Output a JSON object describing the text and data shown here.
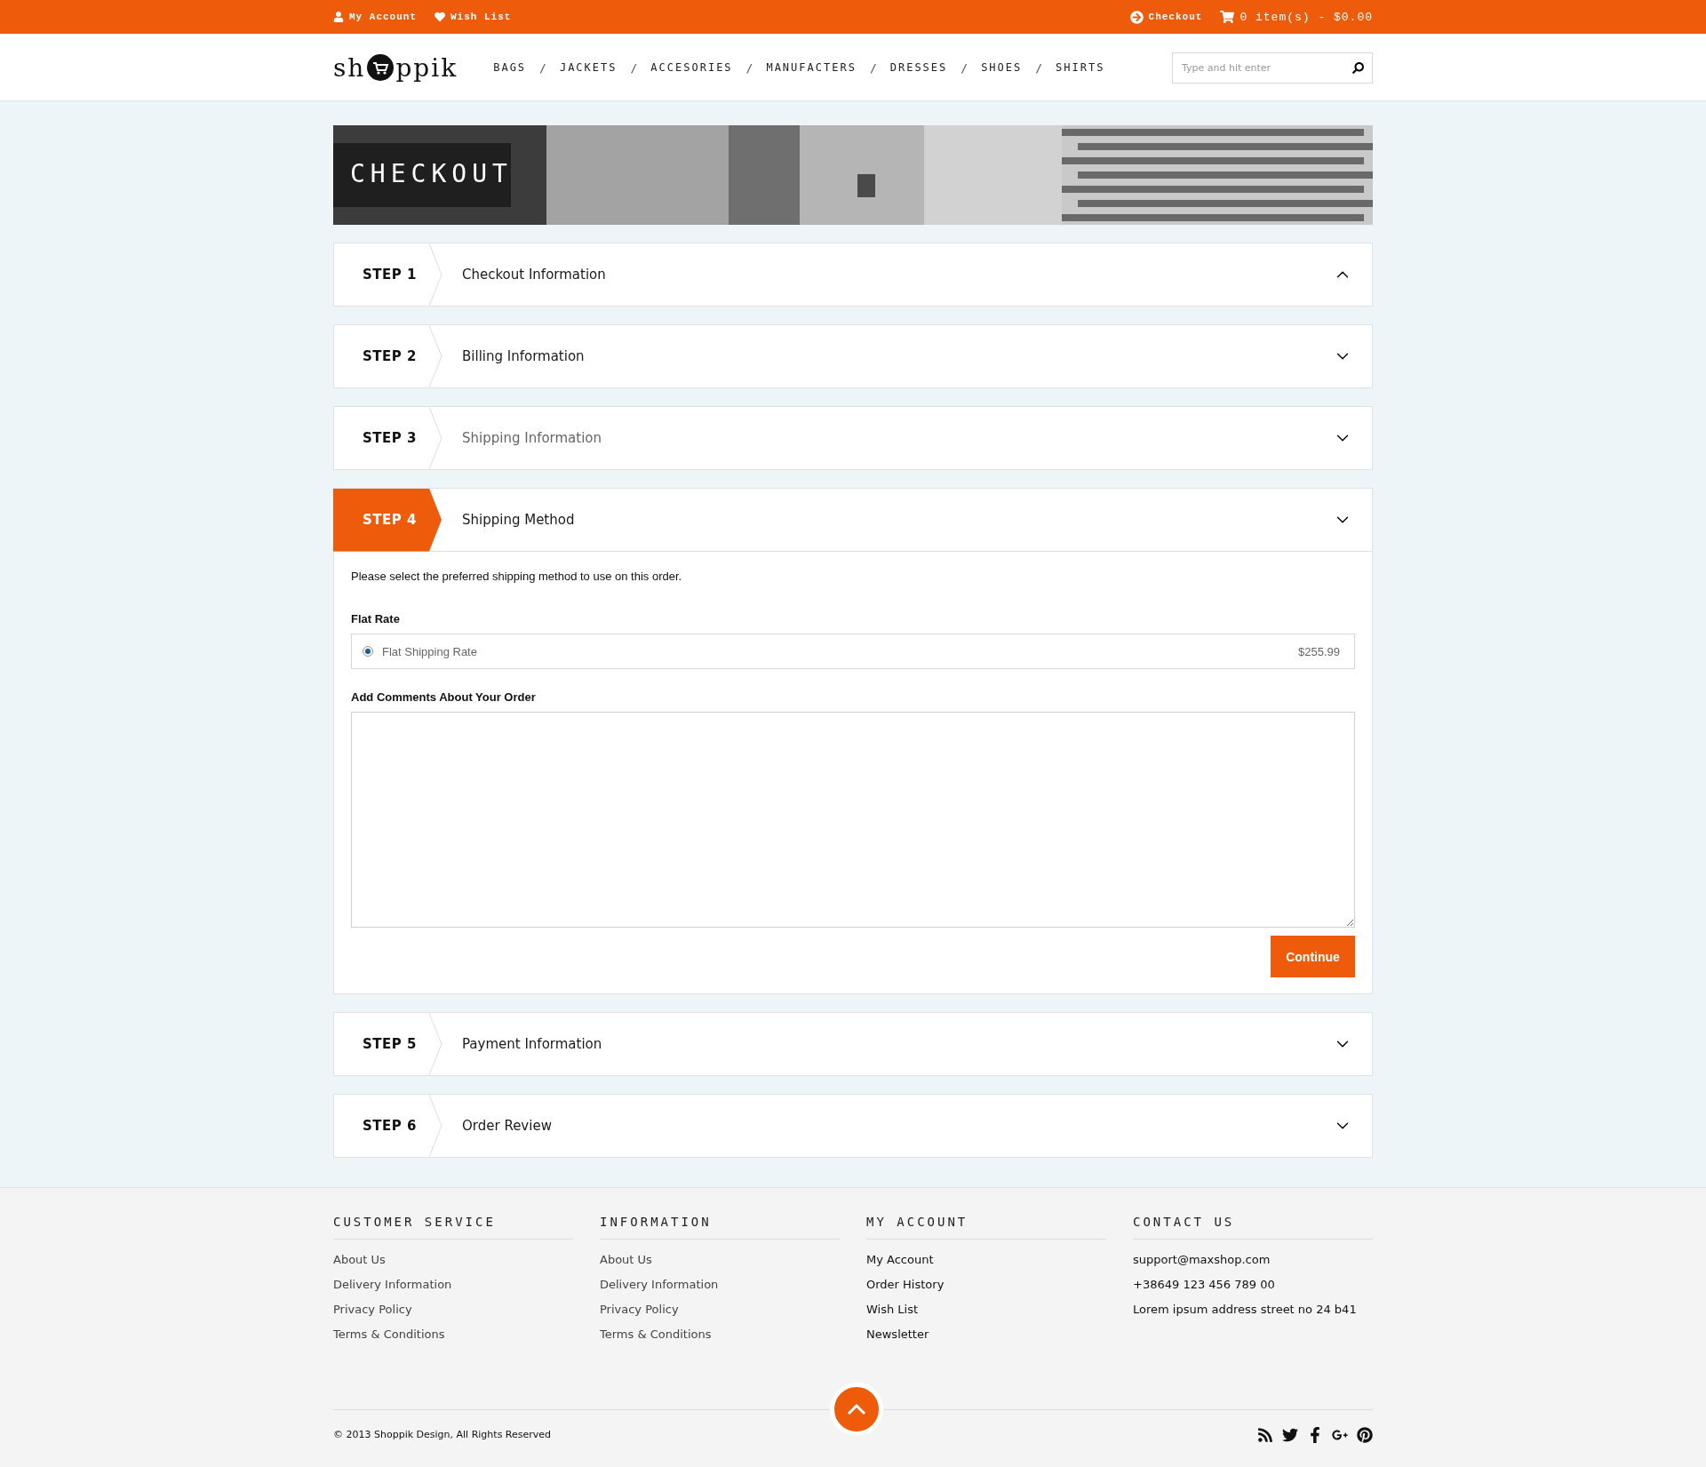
{
  "top_bar": {
    "left": [
      {
        "kind": "user",
        "label": "My Account"
      },
      {
        "kind": "heart",
        "label": "Wish List"
      }
    ],
    "checkout": "Checkout",
    "cart": "0 item(s) - $0.00"
  },
  "header": {
    "logo": {
      "before": "sh",
      "after": "ppik"
    },
    "nav": [
      "BAGS",
      "JACKETS",
      "ACCESORIES",
      "MANUFACTERS",
      "DRESSES",
      "SHOES",
      "SHIRTS"
    ],
    "separator": "/",
    "search": {
      "placeholder": "Type and hit enter"
    }
  },
  "banner": {
    "title": "CHECKOUT"
  },
  "steps": [
    {
      "step": "STEP 1",
      "title": "Checkout Information",
      "selected": false,
      "expanded": true,
      "disabled": false
    },
    {
      "step": "STEP 2",
      "title": "Billing Information",
      "selected": false,
      "expanded": false,
      "disabled": false
    },
    {
      "step": "STEP 3",
      "title": "Shipping Information",
      "selected": false,
      "expanded": false,
      "disabled": true
    },
    {
      "step": "STEP 4",
      "title": "Shipping Method",
      "selected": true,
      "expanded": false,
      "disabled": false
    },
    {
      "step": "STEP 5",
      "title": "Payment Information",
      "selected": false,
      "expanded": false,
      "disabled": false
    },
    {
      "step": "STEP 6",
      "title": "Order Review",
      "selected": false,
      "expanded": false,
      "disabled": false
    }
  ],
  "shipping_method": {
    "intro": "Please select the preferred shipping method to use on this order.",
    "group": "Flat Rate",
    "options": [
      {
        "label": "Flat Shipping Rate",
        "price": "$255.99",
        "selected": true
      }
    ],
    "comments_label": "Add Comments About Your Order",
    "button": "Continue"
  },
  "footer": {
    "columns": [
      {
        "heading": "CUSTOMER SERVICE",
        "kind": "links",
        "items": [
          "About Us",
          "Delivery Information",
          "Privacy Policy",
          "Terms & Conditions"
        ]
      },
      {
        "heading": "INFORMATION",
        "kind": "links",
        "items": [
          "About Us",
          "Delivery Information",
          "Privacy Policy",
          "Terms & Conditions"
        ]
      },
      {
        "heading": "MY ACCOUNT",
        "kind": "links",
        "items": [
          "My Account",
          "Order History",
          "Wish List",
          "Newsletter"
        ]
      },
      {
        "heading": "CONTACT US",
        "kind": "text",
        "items": [
          "support@maxshop.com",
          "+38649 123 456 789 00",
          "Lorem ipsum address street no 24 b41"
        ]
      }
    ],
    "copyright": "© 2013 Shoppik Design, All Rights Reserved"
  }
}
